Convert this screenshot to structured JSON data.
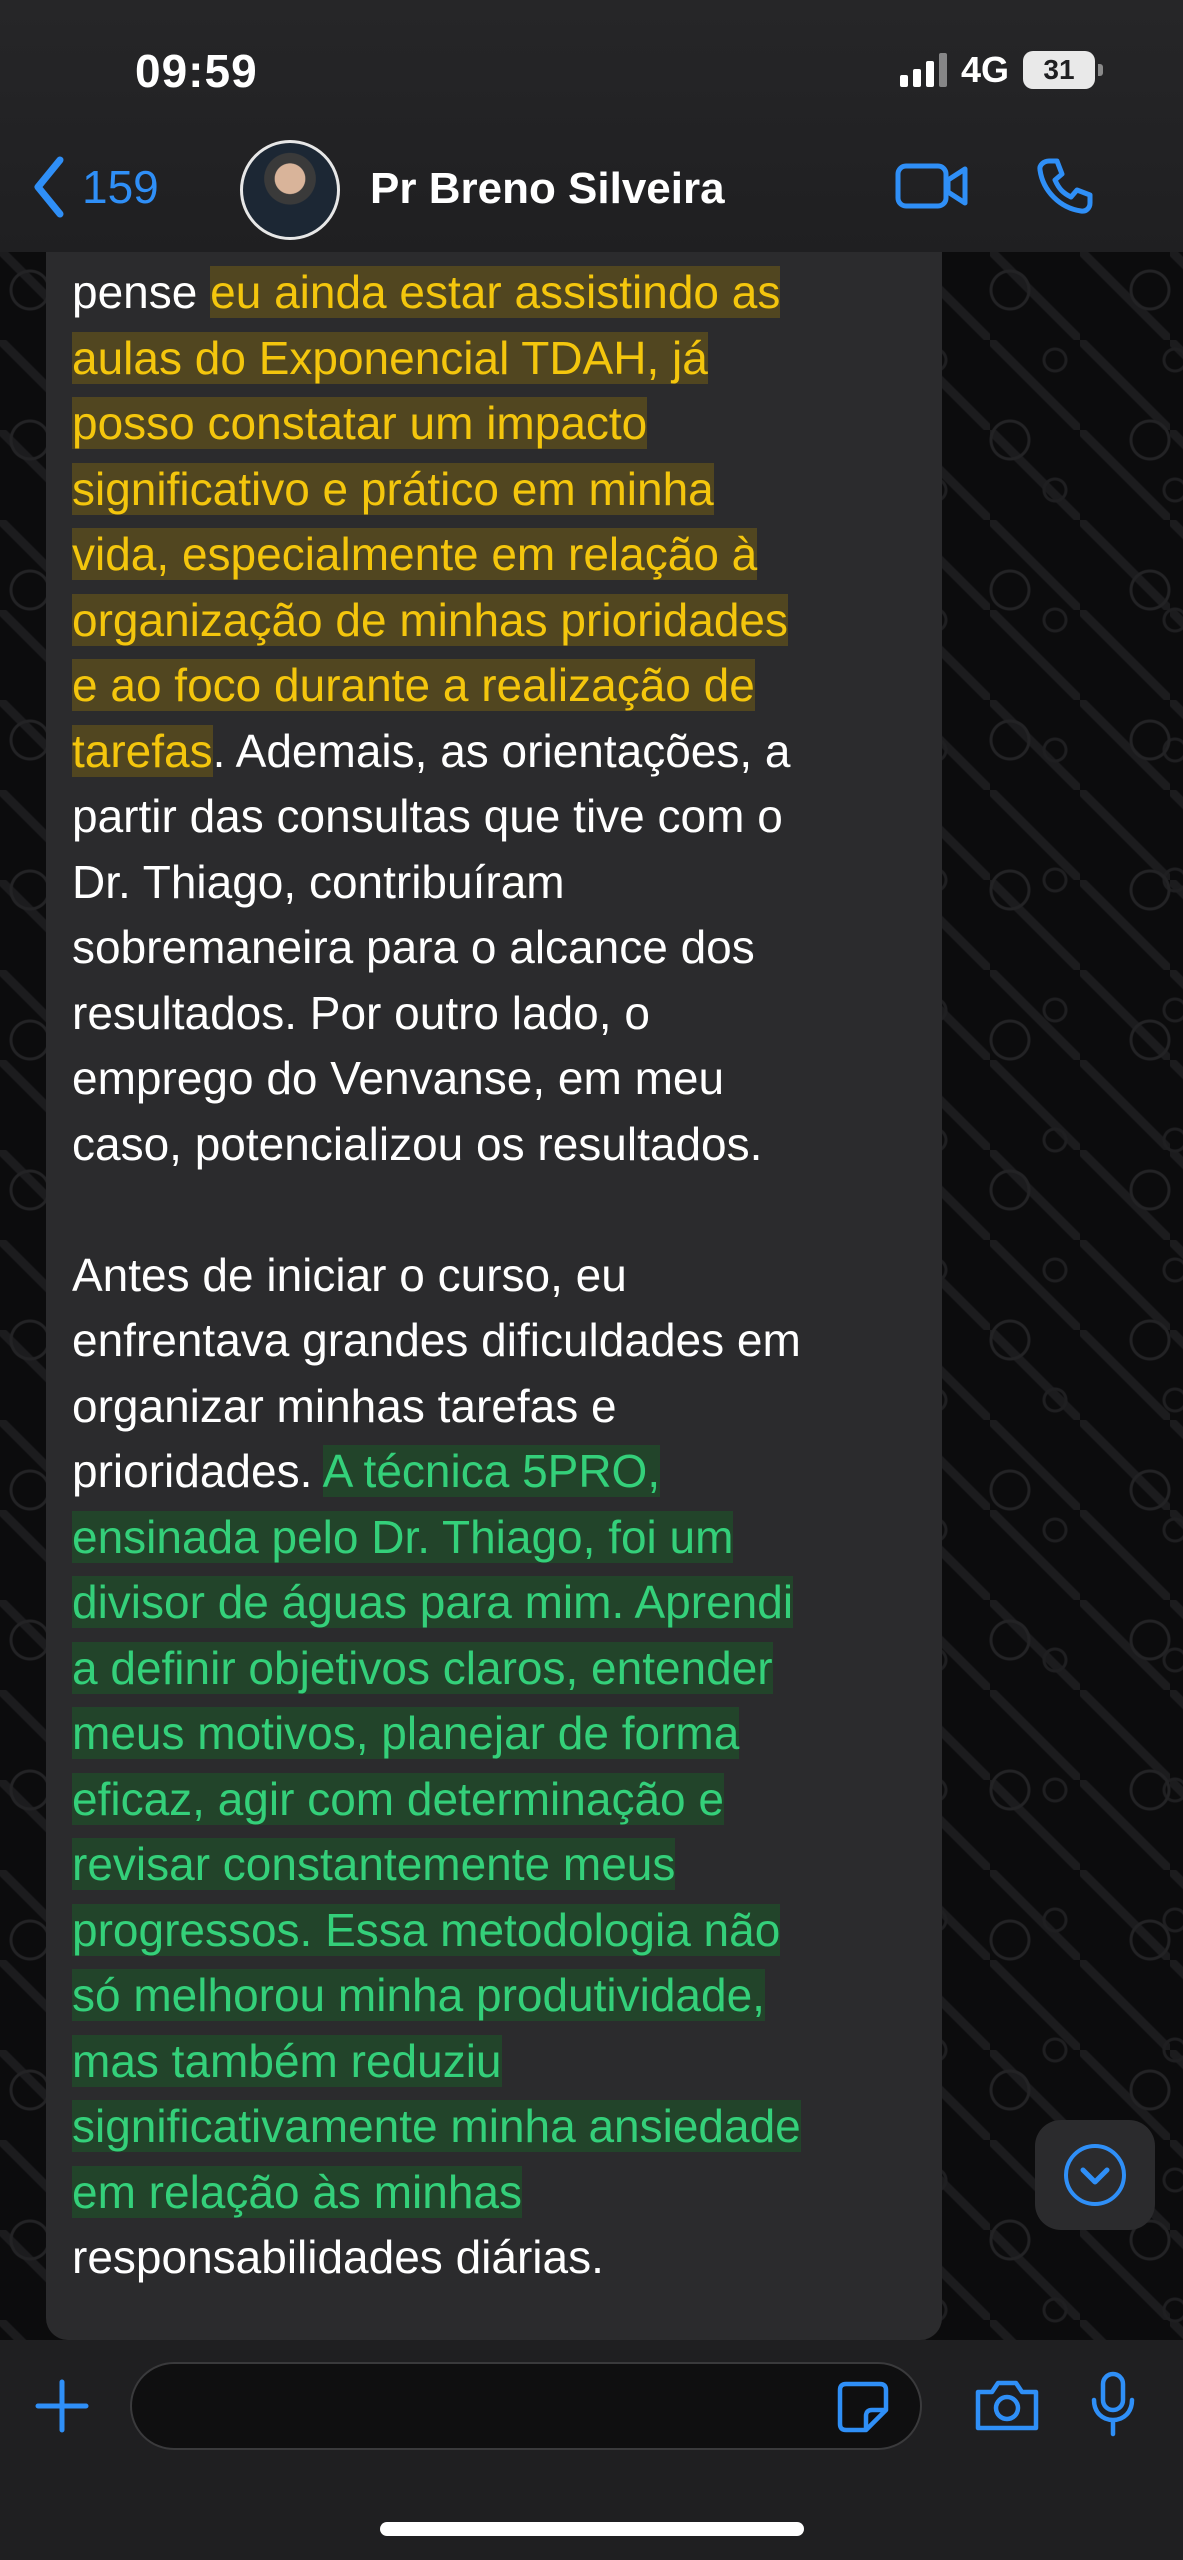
{
  "status_bar": {
    "time": "09:59",
    "network": "4G",
    "battery": "31"
  },
  "header": {
    "back_count": "159",
    "contact_name": "Pr Breno Silveira"
  },
  "message": {
    "segments": [
      {
        "text": "pense ",
        "hl": null
      },
      {
        "text": "eu ainda estar assistindo as\naulas do Exponencial TDAH, já\nposso constatar um impacto\nsignificativo e prático em minha\nvida, especialmente em relação à\norganização de minhas prioridades\ne ao foco durante a realização de\ntarefas",
        "hl": "yellow"
      },
      {
        "text": ". Ademais, as orientações, a\npartir das consultas que tive com o\nDr. Thiago, contribuíram\nsobremaneira para o alcance dos\nresultados. Por outro lado, o\nemprego do Venvanse, em meu\ncaso, potencializou os resultados.\n\nAntes de iniciar o curso, eu\nenfrentava grandes dificuldades em\norganizar minhas tarefas e\nprioridades. ",
        "hl": null
      },
      {
        "text": "A técnica 5PRO,\nensinada pelo Dr. Thiago, foi um\ndivisor de águas para mim. Aprendi\na definir objetivos claros, entender\nmeus motivos, planejar de forma\neficaz, agir com determinação e\nrevisar constantemente meus\nprogressos. Essa metodologia não\nsó melhorou minha produtividade,\nmas também reduziu\nsignificativamente minha ansiedade\nem relação às minhas",
        "hl": "green"
      },
      {
        "text": "\nresponsabilidades diárias.",
        "hl": null
      }
    ]
  },
  "colors": {
    "accent": "#2f8ff7",
    "highlight_yellow": "#f4c60d",
    "highlight_green": "#34d07a"
  },
  "icons": [
    "chevron-left-icon",
    "video-camera-icon",
    "phone-icon",
    "chevron-down-icon",
    "plus-icon",
    "sticker-icon",
    "camera-icon",
    "microphone-icon"
  ]
}
